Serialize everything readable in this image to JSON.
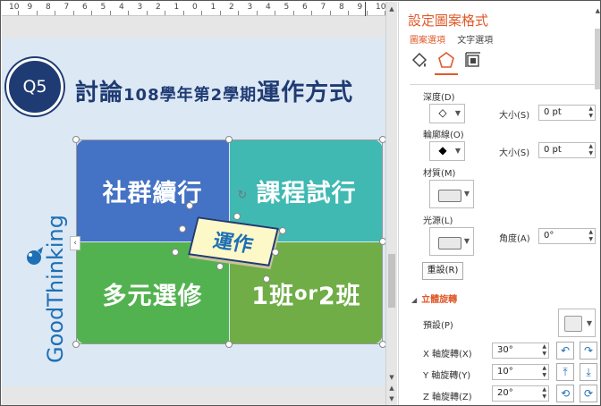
{
  "ruler": {
    "numbers": [
      "10",
      "9",
      "8",
      "7",
      "6",
      "5",
      "4",
      "3",
      "2",
      "1",
      "0",
      "1",
      "2",
      "3",
      "4",
      "5",
      "6",
      "7",
      "8",
      "9",
      "10"
    ]
  },
  "slide": {
    "q_badge": "Q5",
    "title_pre": "討論",
    "title_mid": "108學年第2學期",
    "title_post": "運作方式",
    "brand": "GoodThinking",
    "quadrants": {
      "top_left": "社群續行",
      "top_right": "課程試行",
      "bottom_left": "多元選修",
      "bottom_right_a": "1班",
      "bottom_right_b": "or",
      "bottom_right_c": "2班"
    },
    "center_label": "運作"
  },
  "pane": {
    "title": "設定圖案格式",
    "tabs": [
      "圖案選項",
      "文字選項"
    ],
    "icons": [
      "fill-bucket-icon",
      "pentagon-icon",
      "size-layout-icon"
    ],
    "depth_label": "深度(D)",
    "depth_size_label": "大小(S)",
    "depth_size_value": "0 pt",
    "contour_label": "輪廓線(O)",
    "contour_size_label": "大小(S)",
    "contour_size_value": "0 pt",
    "material_label": "材質(M)",
    "lighting_label": "光源(L)",
    "angle_label": "角度(A)",
    "angle_value": "0°",
    "reset_label": "重設(R)",
    "rotation_section": "立體旋轉",
    "preset_label": "預設(P)",
    "x_label": "X 軸旋轉(X)",
    "x_value": "30°",
    "y_label": "Y 軸旋轉(Y)",
    "y_value": "10°",
    "z_label": "Z 軸旋轉(Z)",
    "z_value": "20°"
  },
  "colors": {
    "accent": "#e0592a",
    "navy": "#1f3b73",
    "blue_quad": "#4472c4",
    "teal_quad": "#3fb9b2",
    "green_quad": "#53b250",
    "olive_quad": "#70ad47",
    "slide_bg": "#dce8f4"
  }
}
